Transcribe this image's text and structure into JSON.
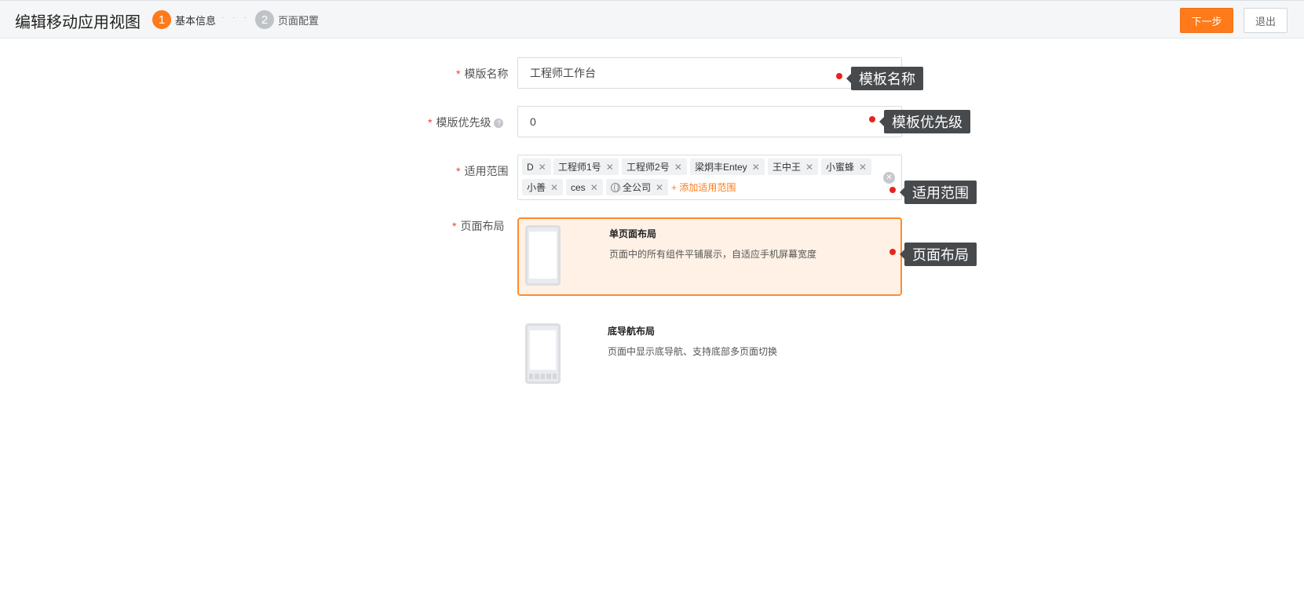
{
  "header": {
    "title": "编辑移动应用视图",
    "steps": [
      {
        "num": "1",
        "label": "基本信息"
      },
      {
        "num": "2",
        "label": "页面配置"
      }
    ],
    "step_dots": "· · · ·",
    "next_label": "下一步",
    "exit_label": "退出",
    "accent_color": "#ff7a1a"
  },
  "form": {
    "required_mark": "*",
    "help_glyph": "?",
    "name": {
      "label": "模版名称",
      "value": "工程师工作台"
    },
    "priority": {
      "label": "模版优先级",
      "value": "0"
    },
    "scope": {
      "label": "适用范围",
      "tags": [
        "D",
        "工程师1号",
        "工程师2号",
        "梁炯丰Entey",
        "王中王",
        "小蜜蜂",
        "小善",
        "ces",
        "全公司"
      ],
      "add_label": "添加适用范围",
      "add_icon": "+",
      "remove_glyph": "✕",
      "clear_glyph": "✕"
    },
    "layout": {
      "label": "页面布局",
      "options": [
        {
          "title": "单页面布局",
          "desc": "页面中的所有组件平铺展示，自适应手机屏幕宽度",
          "selected": true
        },
        {
          "title": "底导航布局",
          "desc": "页面中显示底导航、支持底部多页面切换",
          "selected": false
        }
      ]
    }
  },
  "annotations": [
    "模板名称",
    "模板优先级",
    "适用范围",
    "页面布局"
  ]
}
